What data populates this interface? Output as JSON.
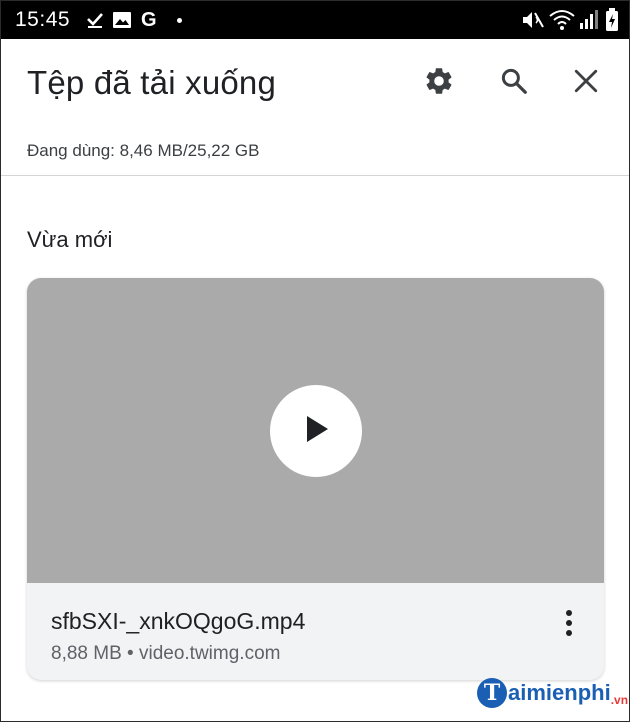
{
  "status_bar": {
    "time": "15:45",
    "left_icons": [
      "check-icon",
      "image-icon",
      "google-g-icon",
      "dot-icon"
    ],
    "g_label": "G",
    "right_icons": [
      "mute-icon",
      "wifi-icon",
      "signal-icon",
      "battery-charging-icon"
    ]
  },
  "toolbar": {
    "title": "Tệp đã tải xuống",
    "buttons": [
      "settings-icon",
      "search-icon",
      "close-icon"
    ]
  },
  "storage": {
    "text": "Đang dùng: 8,46 MB/25,22 GB"
  },
  "section": {
    "title": "Vừa mới"
  },
  "download": {
    "file_name": "sfbSXI-_xnkOQgoG.mp4",
    "meta": "8,88 MB • video.twimg.com",
    "thumbnail_color": "#aaaaaa"
  },
  "watermark": {
    "letter": "T",
    "text": "aimienphi",
    "suffix": ".vn"
  },
  "colors": {
    "status_bar": "#000000",
    "text_primary": "#202124",
    "text_secondary": "#5f6368",
    "card_bg": "#f1f3f4"
  }
}
